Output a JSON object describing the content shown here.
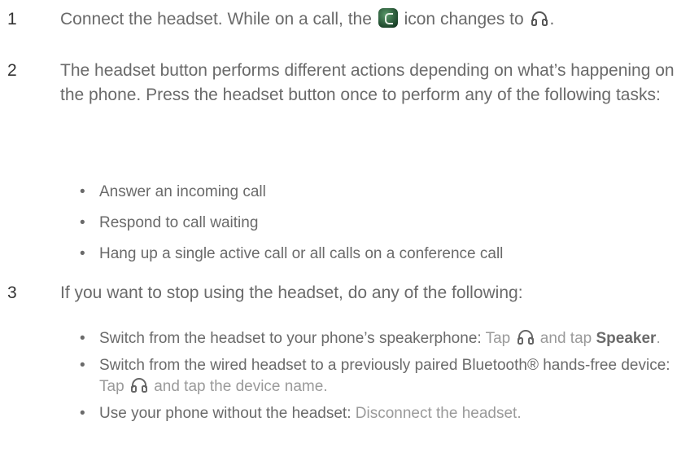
{
  "steps": [
    {
      "number": "1",
      "text_before_icon": "Connect the headset. While on a call, the ",
      "text_middle": " icon changes to ",
      "text_after": ".",
      "icon_from": "phone-call-icon",
      "icon_to": "headset-icon"
    },
    {
      "number": "2",
      "text": "The headset button performs different actions depending on what’s happening on the phone. Press the headset button once to perform any of the following tasks:",
      "bullets": [
        "Answer an incoming call",
        "Respond to call waiting",
        "Hang up a single active call or all calls on a conference call"
      ]
    },
    {
      "number": "3",
      "text": "If you want to stop using the headset, do any of the following:",
      "bullets": [
        {
          "lead": "Switch from the headset to your phone’s speakerphone: ",
          "detail_a": "Tap ",
          "icon": "headset-icon",
          "detail_b": " and tap ",
          "strong": "Speaker",
          "tail": "."
        },
        {
          "lead": "Switch from the wired headset to a previously paired Bluetooth® hands-free device: ",
          "detail_a": "Tap ",
          "icon": "headset-icon",
          "detail_b": " and tap the device name."
        },
        {
          "lead": "Use your phone without the headset: ",
          "detail": "Disconnect the headset."
        }
      ]
    }
  ],
  "colors": {
    "text": "#6a6a6a",
    "number": "#333333",
    "detail": "#9a9a9a"
  }
}
